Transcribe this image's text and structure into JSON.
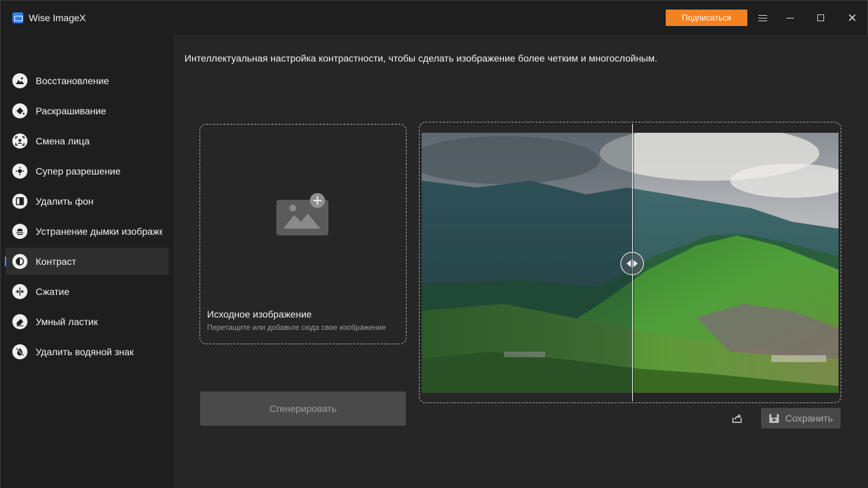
{
  "app": {
    "title": "Wise ImageX",
    "subscribe_label": "Подписаться",
    "accent_color": "#f58220"
  },
  "sidebar": {
    "items": [
      {
        "label": "Восстановление",
        "icon": "landscape-icon",
        "active": false
      },
      {
        "label": "Раскрашивание",
        "icon": "paint-bucket-icon",
        "active": false
      },
      {
        "label": "Смена лица",
        "icon": "face-swap-icon",
        "active": false
      },
      {
        "label": "Супер разрешение",
        "icon": "super-resolution-icon",
        "active": false
      },
      {
        "label": "Удалить фон",
        "icon": "remove-background-icon",
        "active": false
      },
      {
        "label": "Устранение дымки изображе",
        "icon": "dehaze-icon",
        "active": false
      },
      {
        "label": "Контраст",
        "icon": "contrast-icon",
        "active": true
      },
      {
        "label": "Сжатие",
        "icon": "compress-icon",
        "active": false
      },
      {
        "label": "Умный ластик",
        "icon": "eraser-icon",
        "active": false
      },
      {
        "label": "Удалить водяной знак",
        "icon": "remove-watermark-icon",
        "active": false
      }
    ]
  },
  "main": {
    "description": "Интеллектуальная настройка контрастности, чтобы сделать изображение более четким и многослойным.",
    "upload": {
      "title": "Исходное изображение",
      "hint": "Перетащите или добавьте сюда свое изображение"
    },
    "generate_label": "Сгенерировать",
    "save_label": "Сохранить"
  }
}
